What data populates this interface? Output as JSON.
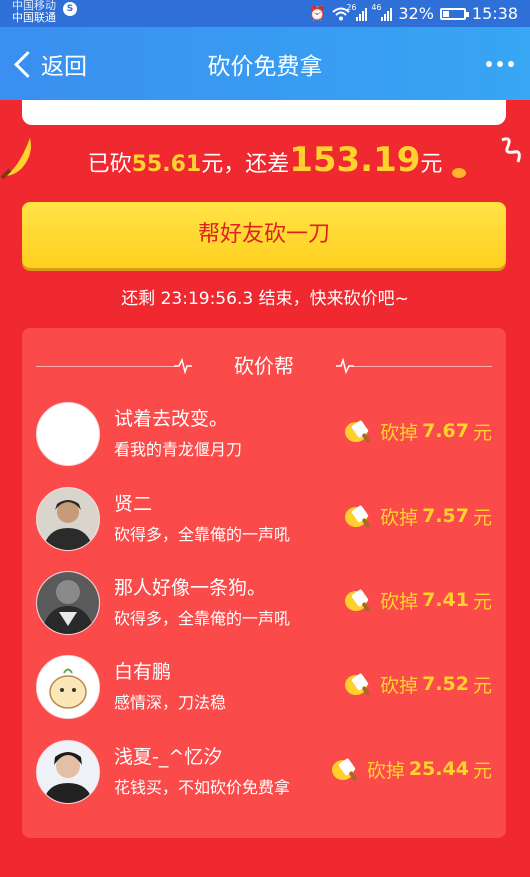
{
  "status_bar": {
    "carrier_1": "中国移动",
    "carrier_2": "中国联通",
    "network_1": "26",
    "network_2": "46",
    "battery": "32%",
    "battery_level": 0.32,
    "time": "15:38"
  },
  "nav": {
    "back_label": "返回",
    "title": "砍价免费拿"
  },
  "progress": {
    "cut_prefix": "已砍",
    "cut_amount": "55.61",
    "cut_suffix": "元，还差",
    "remain_amount": "153.19",
    "remain_suffix": "元"
  },
  "help_button": "帮好友砍一刀",
  "countdown": "还剩 23:19:56.3 结束，快来砍价吧~",
  "helpers_panel": {
    "title": "砍价帮",
    "cut_label": "砍掉",
    "unit": "元",
    "helpers": [
      {
        "name": "试着去改变。",
        "message": "看我的青龙偃月刀",
        "amount": "7.67"
      },
      {
        "name": "贤二",
        "message": "砍得多，全靠俺的一声吼",
        "amount": "7.57"
      },
      {
        "name": "那人好像一条狗。",
        "message": "砍得多，全靠俺的一声吼",
        "amount": "7.41"
      },
      {
        "name": "白有鹏",
        "message": "感情深，刀法稳",
        "amount": "7.52"
      },
      {
        "name": "浅夏-_^忆汐",
        "message": "花钱买，不如砍价免费拿",
        "amount": "25.44"
      }
    ]
  },
  "colors": {
    "background": "#f0282f",
    "nav": "#3a8ff0",
    "accent_yellow": "#ffd22e",
    "button": "#ffd01f"
  }
}
